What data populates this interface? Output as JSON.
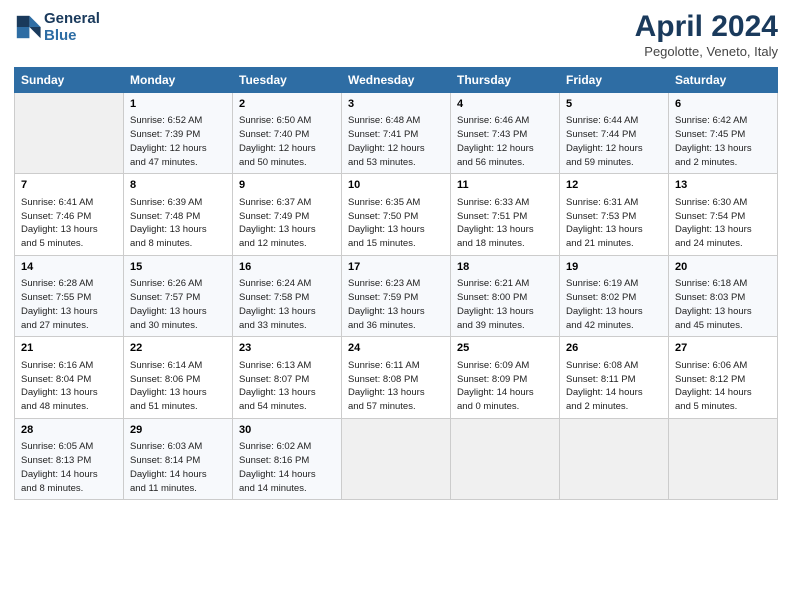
{
  "header": {
    "logo_line1": "General",
    "logo_line2": "Blue",
    "title": "April 2024",
    "subtitle": "Pegolotte, Veneto, Italy"
  },
  "days_of_week": [
    "Sunday",
    "Monday",
    "Tuesday",
    "Wednesday",
    "Thursday",
    "Friday",
    "Saturday"
  ],
  "weeks": [
    [
      {
        "day": "",
        "info": ""
      },
      {
        "day": "1",
        "info": "Sunrise: 6:52 AM\nSunset: 7:39 PM\nDaylight: 12 hours\nand 47 minutes."
      },
      {
        "day": "2",
        "info": "Sunrise: 6:50 AM\nSunset: 7:40 PM\nDaylight: 12 hours\nand 50 minutes."
      },
      {
        "day": "3",
        "info": "Sunrise: 6:48 AM\nSunset: 7:41 PM\nDaylight: 12 hours\nand 53 minutes."
      },
      {
        "day": "4",
        "info": "Sunrise: 6:46 AM\nSunset: 7:43 PM\nDaylight: 12 hours\nand 56 minutes."
      },
      {
        "day": "5",
        "info": "Sunrise: 6:44 AM\nSunset: 7:44 PM\nDaylight: 12 hours\nand 59 minutes."
      },
      {
        "day": "6",
        "info": "Sunrise: 6:42 AM\nSunset: 7:45 PM\nDaylight: 13 hours\nand 2 minutes."
      }
    ],
    [
      {
        "day": "7",
        "info": "Sunrise: 6:41 AM\nSunset: 7:46 PM\nDaylight: 13 hours\nand 5 minutes."
      },
      {
        "day": "8",
        "info": "Sunrise: 6:39 AM\nSunset: 7:48 PM\nDaylight: 13 hours\nand 8 minutes."
      },
      {
        "day": "9",
        "info": "Sunrise: 6:37 AM\nSunset: 7:49 PM\nDaylight: 13 hours\nand 12 minutes."
      },
      {
        "day": "10",
        "info": "Sunrise: 6:35 AM\nSunset: 7:50 PM\nDaylight: 13 hours\nand 15 minutes."
      },
      {
        "day": "11",
        "info": "Sunrise: 6:33 AM\nSunset: 7:51 PM\nDaylight: 13 hours\nand 18 minutes."
      },
      {
        "day": "12",
        "info": "Sunrise: 6:31 AM\nSunset: 7:53 PM\nDaylight: 13 hours\nand 21 minutes."
      },
      {
        "day": "13",
        "info": "Sunrise: 6:30 AM\nSunset: 7:54 PM\nDaylight: 13 hours\nand 24 minutes."
      }
    ],
    [
      {
        "day": "14",
        "info": "Sunrise: 6:28 AM\nSunset: 7:55 PM\nDaylight: 13 hours\nand 27 minutes."
      },
      {
        "day": "15",
        "info": "Sunrise: 6:26 AM\nSunset: 7:57 PM\nDaylight: 13 hours\nand 30 minutes."
      },
      {
        "day": "16",
        "info": "Sunrise: 6:24 AM\nSunset: 7:58 PM\nDaylight: 13 hours\nand 33 minutes."
      },
      {
        "day": "17",
        "info": "Sunrise: 6:23 AM\nSunset: 7:59 PM\nDaylight: 13 hours\nand 36 minutes."
      },
      {
        "day": "18",
        "info": "Sunrise: 6:21 AM\nSunset: 8:00 PM\nDaylight: 13 hours\nand 39 minutes."
      },
      {
        "day": "19",
        "info": "Sunrise: 6:19 AM\nSunset: 8:02 PM\nDaylight: 13 hours\nand 42 minutes."
      },
      {
        "day": "20",
        "info": "Sunrise: 6:18 AM\nSunset: 8:03 PM\nDaylight: 13 hours\nand 45 minutes."
      }
    ],
    [
      {
        "day": "21",
        "info": "Sunrise: 6:16 AM\nSunset: 8:04 PM\nDaylight: 13 hours\nand 48 minutes."
      },
      {
        "day": "22",
        "info": "Sunrise: 6:14 AM\nSunset: 8:06 PM\nDaylight: 13 hours\nand 51 minutes."
      },
      {
        "day": "23",
        "info": "Sunrise: 6:13 AM\nSunset: 8:07 PM\nDaylight: 13 hours\nand 54 minutes."
      },
      {
        "day": "24",
        "info": "Sunrise: 6:11 AM\nSunset: 8:08 PM\nDaylight: 13 hours\nand 57 minutes."
      },
      {
        "day": "25",
        "info": "Sunrise: 6:09 AM\nSunset: 8:09 PM\nDaylight: 14 hours\nand 0 minutes."
      },
      {
        "day": "26",
        "info": "Sunrise: 6:08 AM\nSunset: 8:11 PM\nDaylight: 14 hours\nand 2 minutes."
      },
      {
        "day": "27",
        "info": "Sunrise: 6:06 AM\nSunset: 8:12 PM\nDaylight: 14 hours\nand 5 minutes."
      }
    ],
    [
      {
        "day": "28",
        "info": "Sunrise: 6:05 AM\nSunset: 8:13 PM\nDaylight: 14 hours\nand 8 minutes."
      },
      {
        "day": "29",
        "info": "Sunrise: 6:03 AM\nSunset: 8:14 PM\nDaylight: 14 hours\nand 11 minutes."
      },
      {
        "day": "30",
        "info": "Sunrise: 6:02 AM\nSunset: 8:16 PM\nDaylight: 14 hours\nand 14 minutes."
      },
      {
        "day": "",
        "info": ""
      },
      {
        "day": "",
        "info": ""
      },
      {
        "day": "",
        "info": ""
      },
      {
        "day": "",
        "info": ""
      }
    ]
  ]
}
